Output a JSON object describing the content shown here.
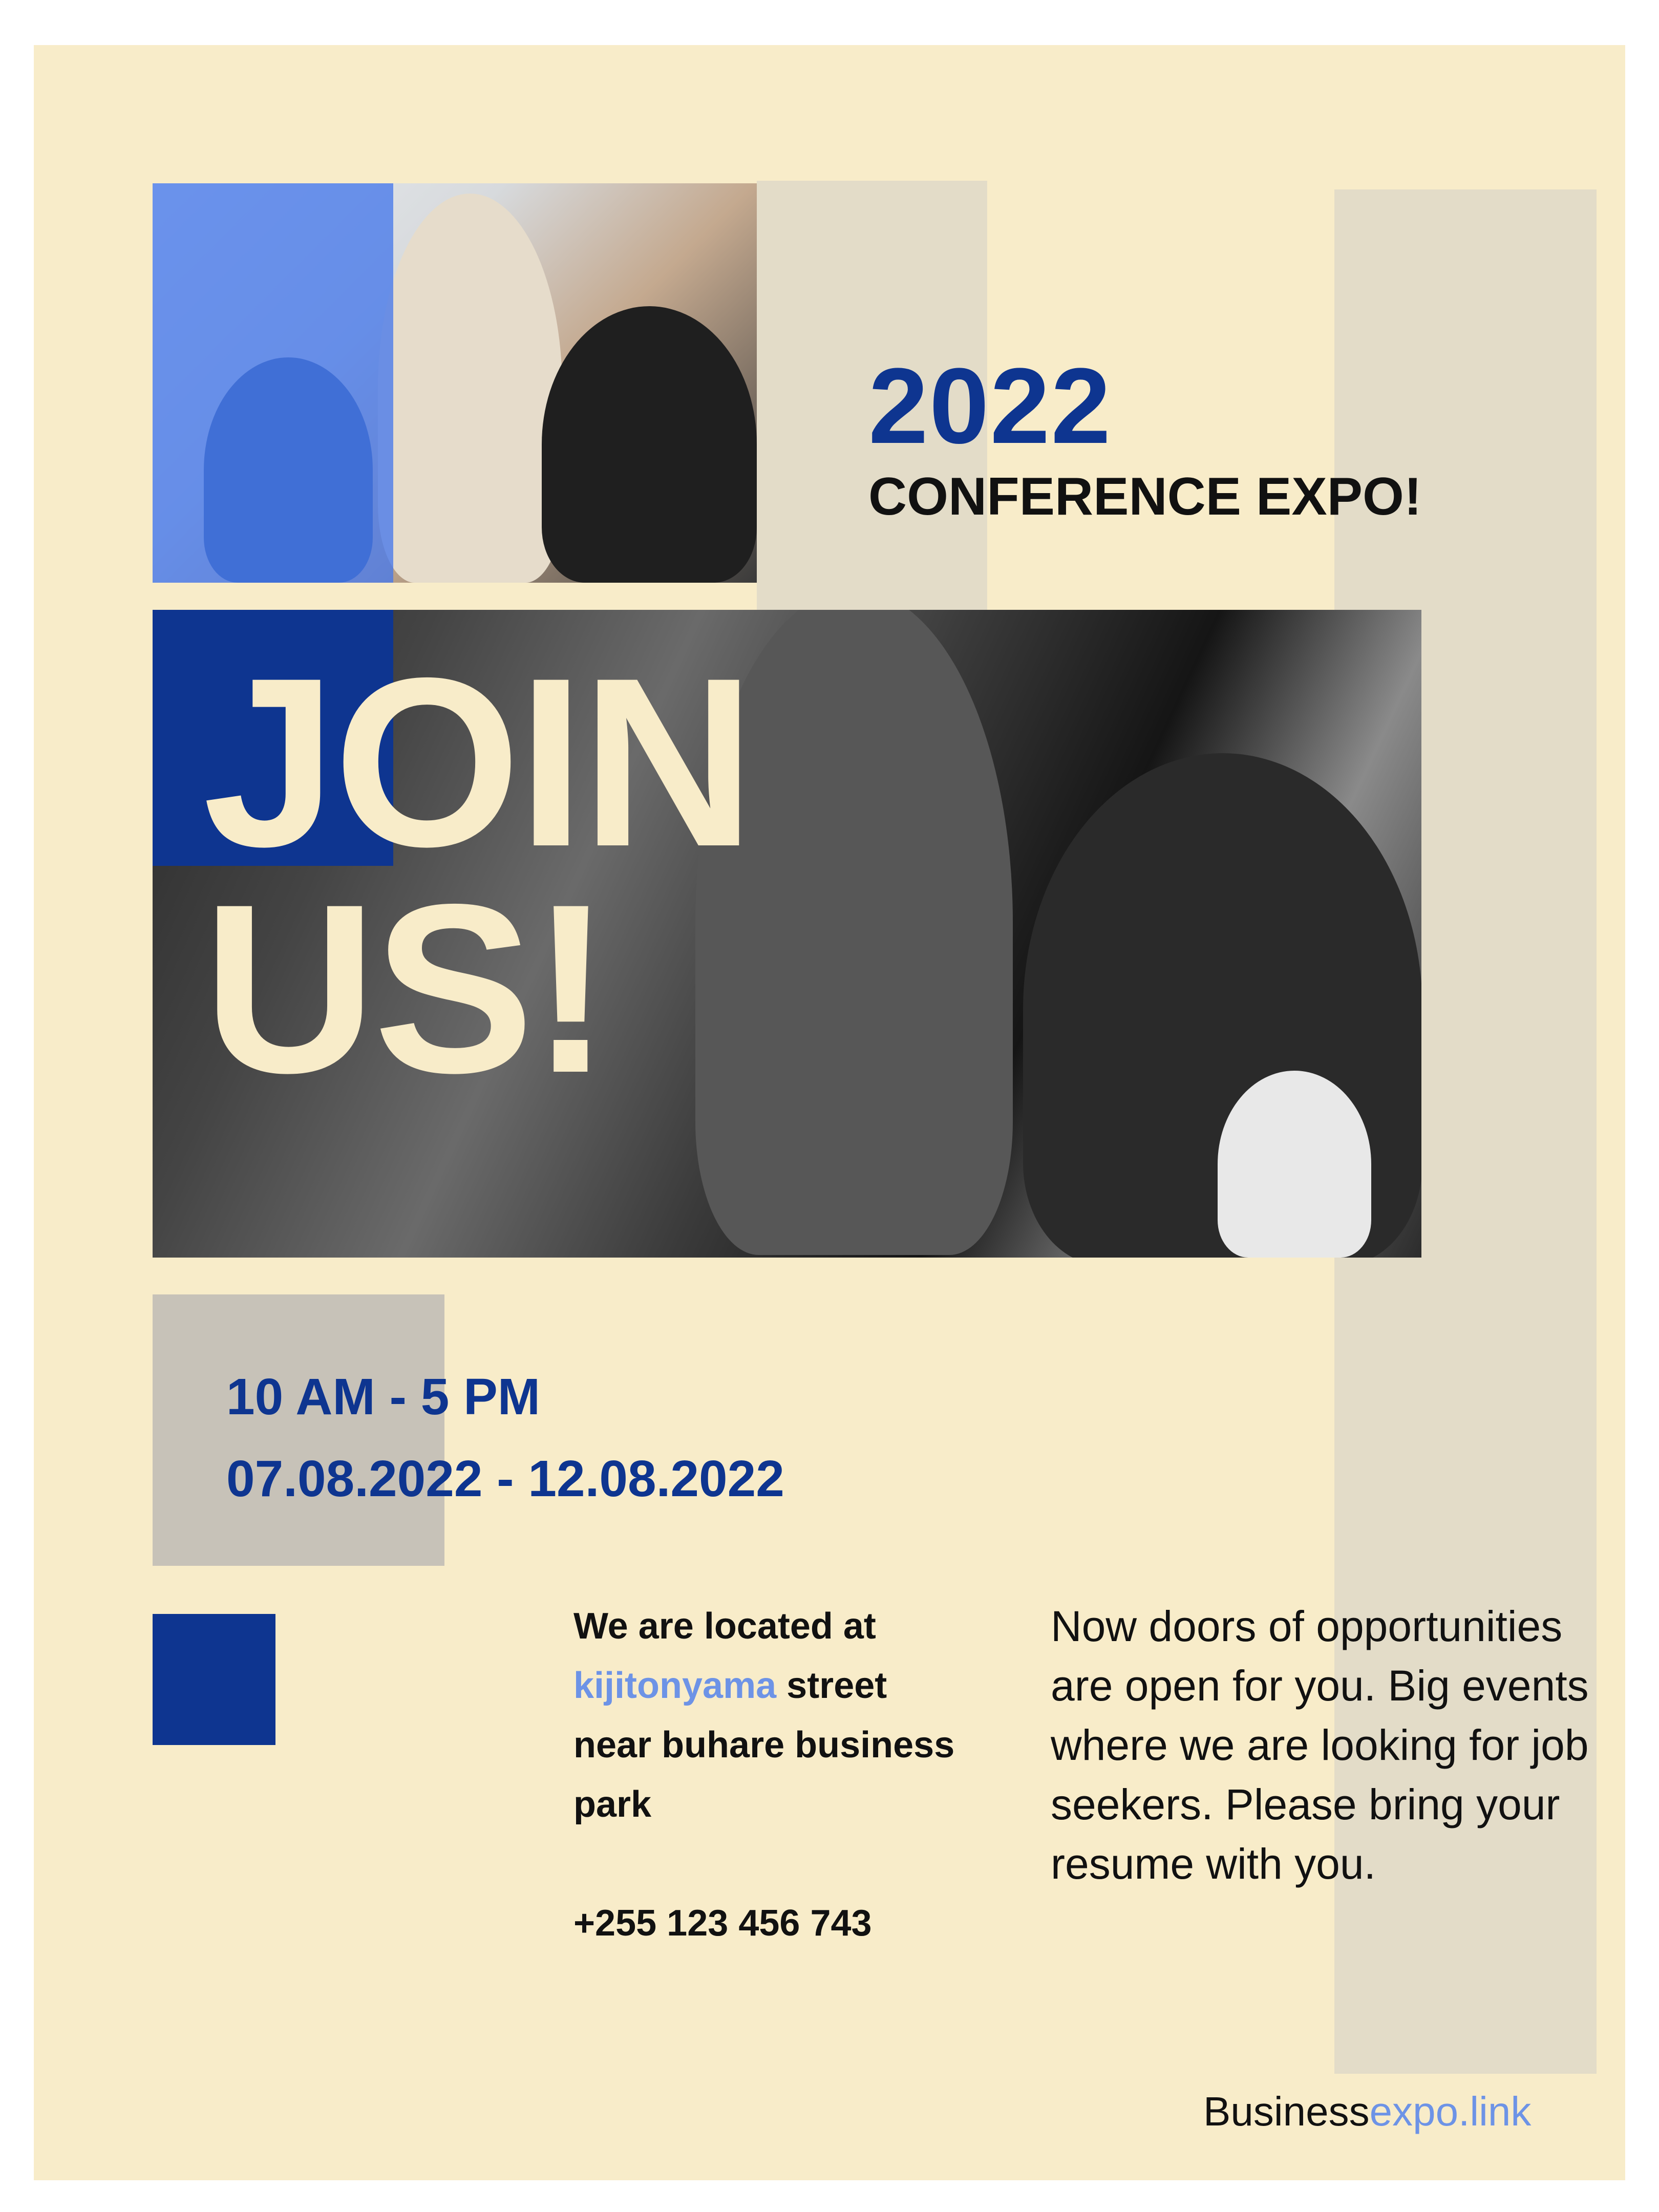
{
  "header": {
    "year": "2022",
    "subtitle": "CONFERENCE EXPO!"
  },
  "headline": {
    "line1": "JOIN",
    "line2": "US!"
  },
  "schedule": {
    "time": "10 AM - 5 PM",
    "dates": "07.08.2022 - 12.08.2022"
  },
  "location": {
    "intro": "We are located at",
    "street_name": "kijitonyama",
    "street_suffix": "street",
    "rest": "near buhare business park",
    "phone": "+255 123 456 743"
  },
  "description": "Now doors of opportunities are open for you. Big events where we are looking for job seekers. Please bring your resume with you.",
  "footer": {
    "site_prefix": "Business",
    "site_suffix": "expo.link"
  },
  "colors": {
    "background": "#f8ecc9",
    "navy": "#0e3590",
    "accent_blue": "#6d93e6",
    "beige_bar": "#e3dcc8",
    "gray_box": "#c7c2b8"
  }
}
